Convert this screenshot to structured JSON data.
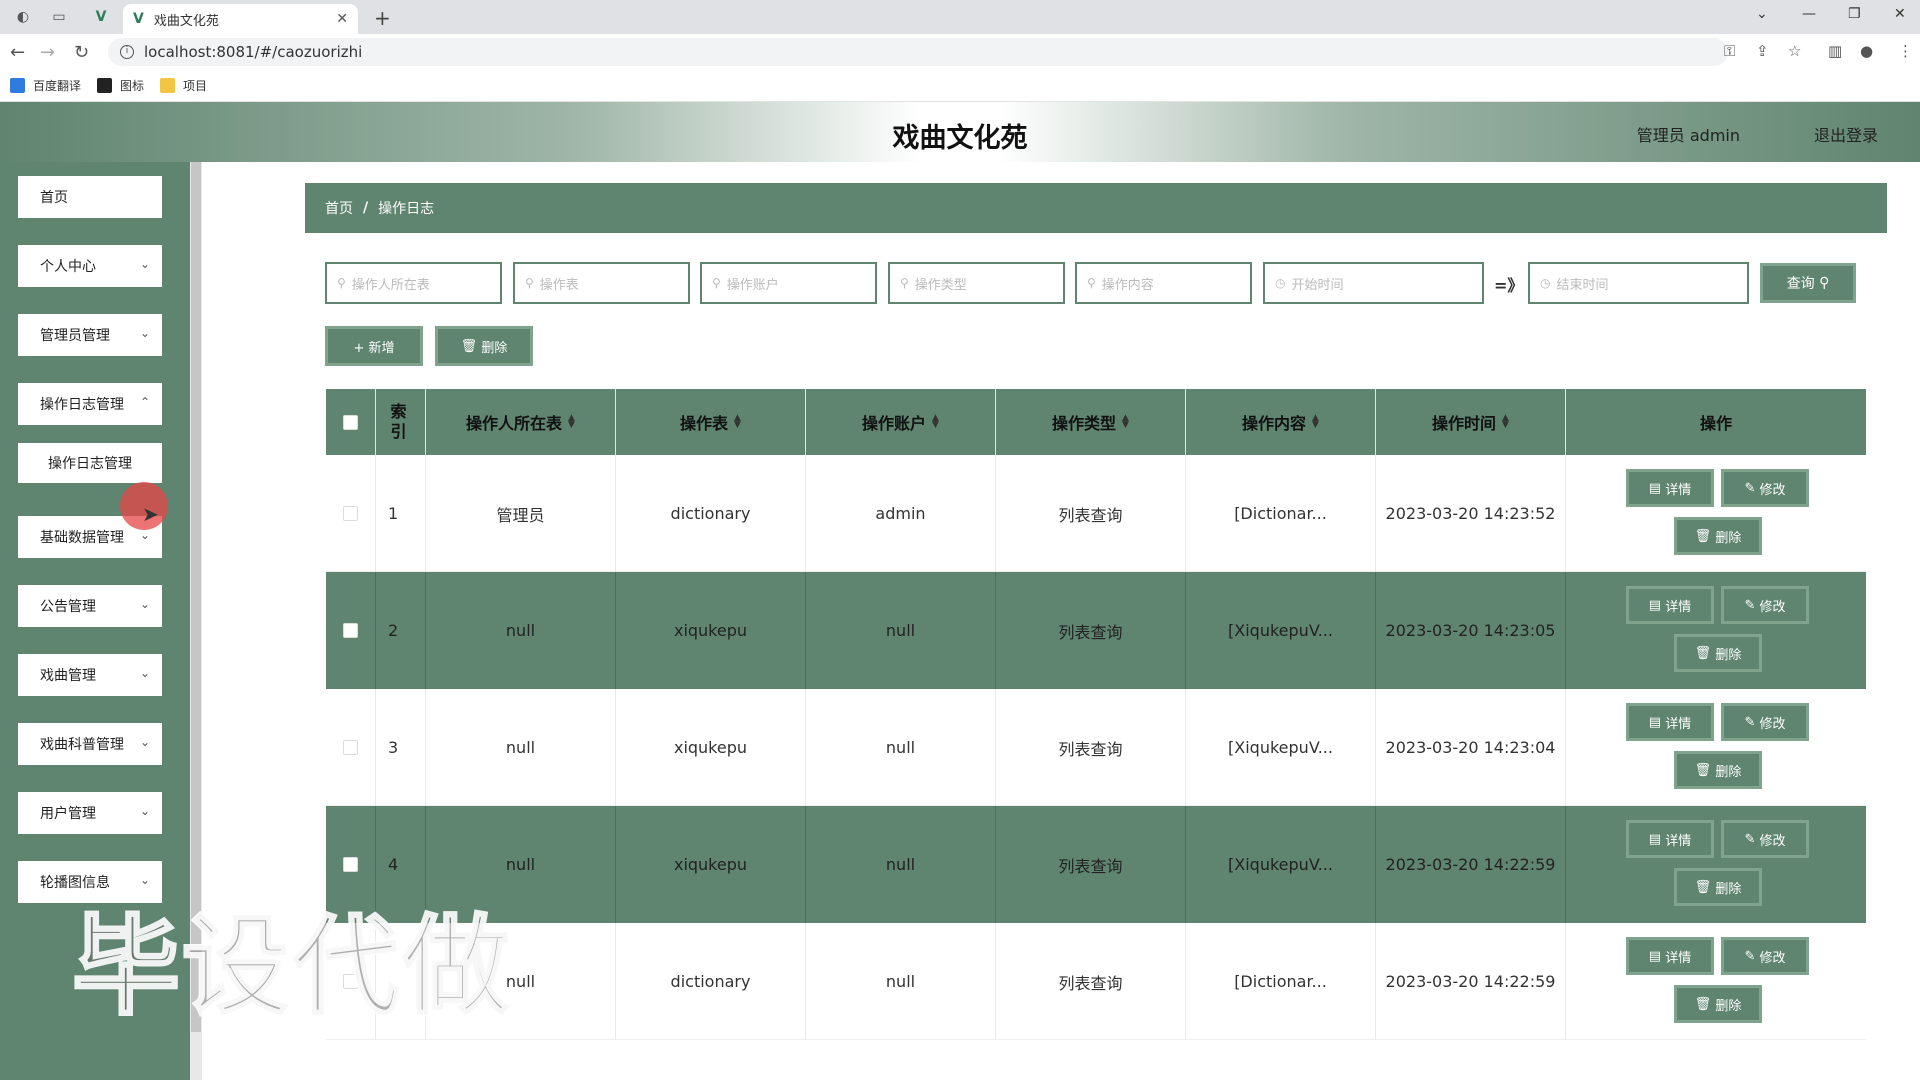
{
  "browser": {
    "tab_title": "戏曲文化苑",
    "url": "localhost:8081/#/caozuorizhi",
    "bookmarks": [
      "百度翻译",
      "图标",
      "项目"
    ]
  },
  "header": {
    "title": "戏曲文化苑",
    "user": "管理员 admin",
    "logout": "退出登录"
  },
  "sidebar": {
    "items": [
      {
        "label": "首页",
        "has_children": false
      },
      {
        "label": "个人中心",
        "has_children": true
      },
      {
        "label": "管理员管理",
        "has_children": true
      },
      {
        "label": "操作日志管理",
        "has_children": true
      },
      {
        "label": "基础数据管理",
        "has_children": true
      },
      {
        "label": "公告管理",
        "has_children": true
      },
      {
        "label": "戏曲管理",
        "has_children": true
      },
      {
        "label": "戏曲科普管理",
        "has_children": true
      },
      {
        "label": "用户管理",
        "has_children": true
      },
      {
        "label": "轮播图信息",
        "has_children": true
      }
    ],
    "submenu": {
      "label": "操作日志管理"
    }
  },
  "breadcrumb": {
    "home": "首页",
    "separator": "/",
    "current": "操作日志"
  },
  "search": {
    "placeholders": [
      "操作人所在表",
      "操作表",
      "操作账户",
      "操作类型",
      "操作内容",
      "开始时间",
      "结束时间"
    ],
    "range_separator": "=》",
    "query_label": "查询"
  },
  "toolbar": {
    "add_label": "+ 新增",
    "delete_label": "删除"
  },
  "table": {
    "headers": [
      "索引",
      "操作人所在表",
      "操作表",
      "操作账户",
      "操作类型",
      "操作内容",
      "操作时间",
      "操作"
    ],
    "rows": [
      {
        "index": "1",
        "user_table": "管理员",
        "op_table": "dictionary",
        "account": "admin",
        "type": "列表查询",
        "content": "[Dictionar...",
        "time": "2023-03-20 14:23:52"
      },
      {
        "index": "2",
        "user_table": "null",
        "op_table": "xiqukepu",
        "account": "null",
        "type": "列表查询",
        "content": "[XiqukepuV...",
        "time": "2023-03-20 14:23:05"
      },
      {
        "index": "3",
        "user_table": "null",
        "op_table": "xiqukepu",
        "account": "null",
        "type": "列表查询",
        "content": "[XiqukepuV...",
        "time": "2023-03-20 14:23:04"
      },
      {
        "index": "4",
        "user_table": "null",
        "op_table": "xiqukepu",
        "account": "null",
        "type": "列表查询",
        "content": "[XiqukepuV...",
        "time": "2023-03-20 14:22:59"
      },
      {
        "index": "",
        "user_table": "null",
        "op_table": "dictionary",
        "account": "null",
        "type": "列表查询",
        "content": "[Dictionar...",
        "time": "2023-03-20 14:22:59"
      }
    ],
    "actions": {
      "detail": "详情",
      "edit": "修改",
      "delete": "删除"
    }
  },
  "watermark": "毕设代做",
  "colors": {
    "primary": "#5f8470",
    "border": "#7fa38d"
  }
}
